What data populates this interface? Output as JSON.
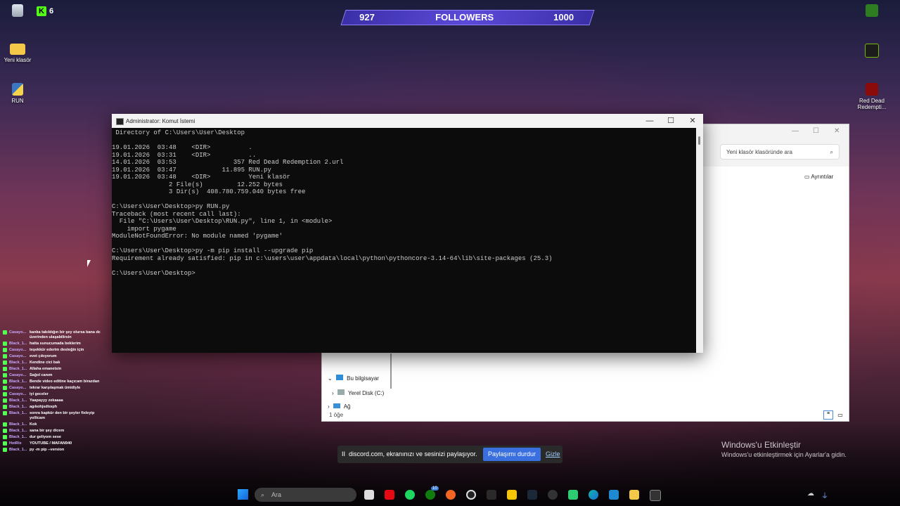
{
  "desktop": {
    "icons": [
      {
        "label": ""
      },
      {
        "label": "Yeni klasör"
      },
      {
        "label": "RUN"
      },
      {
        "label": "Red Dead Redempti..."
      }
    ],
    "kick_count": "6"
  },
  "followers": {
    "current": "927",
    "label": "FOLLOWERS",
    "goal": "1000"
  },
  "cmd": {
    "title": "Administrator: Komut İstemi",
    "lines": [
      " Directory of C:\\Users\\User\\Desktop",
      "",
      "19.01.2026  03:48    <DIR>          .",
      "19.01.2026  03:31    <DIR>          ..",
      "14.01.2026  03:53               357 Red Dead Redemption 2.url",
      "19.01.2026  03:47            11.895 RUN.py",
      "19.01.2026  03:48    <DIR>          Yeni klasör",
      "               2 File(s)         12.252 bytes",
      "               3 Dir(s)  408.780.759.040 bytes free",
      "",
      "C:\\Users\\User\\Desktop>py RUN.py",
      "Traceback (most recent call last):",
      "  File \"C:\\Users\\User\\Desktop\\RUN.py\", line 1, in <module>",
      "    import pygame",
      "ModuleNotFoundError: No module named 'pygame'",
      "",
      "C:\\Users\\User\\Desktop>py -m pip install --upgrade pip",
      "Requirement already satisfied: pip in c:\\users\\user\\appdata\\local\\python\\pythoncore-3.14-64\\lib\\site-packages (25.3)",
      "",
      "C:\\Users\\User\\Desktop>"
    ],
    "minimize": "—",
    "maximize": "☐",
    "close": "✕"
  },
  "explorer": {
    "search_placeholder": "Yeni klasör klasöründe ara",
    "details_label": "Ayrıntılar",
    "nav": {
      "this_pc": "Bu bilgisayar",
      "local_disk": "Yerel Disk (C:)",
      "network": "Ağ"
    },
    "status": "1 öğe"
  },
  "chat": [
    {
      "name": "Casayo...",
      "msg": "kanka takıldığın bir şey olursa bana dc üzerinden ulaşabilirsin"
    },
    {
      "name": "Black_1...",
      "msg": "hatta sunucumada beklerim"
    },
    {
      "name": "Casayo...",
      "msg": "teşekkür ederim desteğin için"
    },
    {
      "name": "Casayo...",
      "msg": "evet çıkıyorum"
    },
    {
      "name": "Black_1...",
      "msg": "Kendine cici bak"
    },
    {
      "name": "Black_1...",
      "msg": "Allaha emanetsin"
    },
    {
      "name": "Casayo...",
      "msg": "Sağol canım"
    },
    {
      "name": "Black_1...",
      "msg": "Bende video editine kaçıcam birazdan"
    },
    {
      "name": "Casayo...",
      "msg": "tekrar karşılaşmak ümidiyle"
    },
    {
      "name": "Casayo...",
      "msg": "iyi geceler"
    },
    {
      "name": "Black_1...",
      "msg": "Yaapayyy zekaaaa"
    },
    {
      "name": "Black_1...",
      "msg": "agıkohjsdtoıph"
    },
    {
      "name": "Black_1...",
      "msg": "sonra kapkür den bir şeyler fixleyip yollicam"
    },
    {
      "name": "Black_1...",
      "msg": "Kok"
    },
    {
      "name": "Black_1...",
      "msg": "sana bir şey dicem"
    },
    {
      "name": "Black_1...",
      "msg": "dur geliyom sese"
    },
    {
      "name": "HotRix",
      "msg": "YOUTUBE / MAFAN940"
    },
    {
      "name": "Black_1...",
      "msg": "py -m pip --version"
    }
  ],
  "share_bar": {
    "pause_glyph": "II",
    "text": "discord.com, ekranınızı ve sesinizi paylaşıyor.",
    "stop": "Paylaşımı durdur",
    "hide": "Gizle"
  },
  "activate": {
    "title": "Windows'u Etkinleştir",
    "subtitle": "Windows'u etkinleştirmek için Ayarlar'a gidin."
  },
  "taskbar": {
    "search_placeholder": "Ara",
    "badge": "10"
  }
}
